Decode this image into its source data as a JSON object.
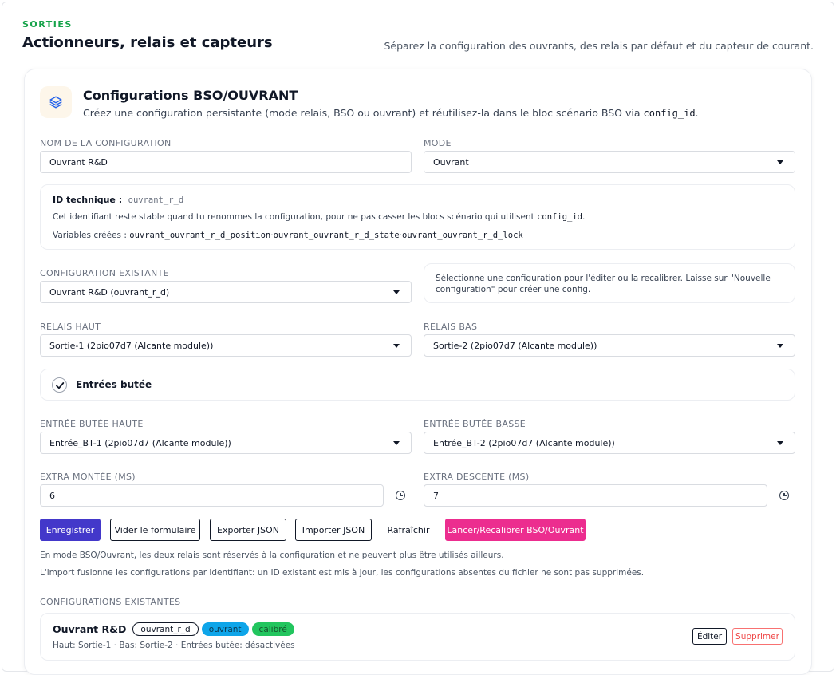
{
  "section": {
    "tag": "SORTIES",
    "title": "Actionneurs, relais et capteurs",
    "description": "Séparez la configuration des ouvrants, des relais par défaut et du capteur de courant."
  },
  "card": {
    "icon": "layers-icon",
    "title": "Configurations BSO/OUVRANT",
    "subtitle_before": "Créez une configuration persistante (mode relais, BSO ou ouvrant) et réutilisez-la dans le bloc scénario BSO via",
    "subtitle_code": "config_id",
    "subtitle_after": "."
  },
  "form": {
    "name_label": "NOM DE LA CONFIGURATION",
    "name_value": "Ouvrant R&D",
    "mode_label": "MODE",
    "mode_value": "Ouvrant",
    "tech_id_label": "ID technique :",
    "tech_id_value": "ouvrant_r_d",
    "tech_id_note_before": "Cet identifiant reste stable quand tu renommes la configuration, pour ne pas casser les blocs scénario qui utilisent",
    "tech_id_note_code": "config_id",
    "tech_id_note_after": ".",
    "variables_label": "Variables créées :",
    "variable_1": "ouvrant_ouvrant_r_d_position",
    "variable_2": "ouvrant_ouvrant_r_d_state",
    "variable_3": "ouvrant_ouvrant_r_d_lock",
    "variable_sep": "·",
    "existing_label": "CONFIGURATION EXISTANTE",
    "existing_value": "Ouvrant R&D (ouvrant_r_d)",
    "existing_help": "Sélectionne une configuration pour l'éditer ou la recalibrer. Laisse sur \"Nouvelle configuration\" pour créer une config.",
    "relay_up_label": "RELAIS HAUT",
    "relay_up_value": "Sortie-1 (2pio07d7 (Alcante module))",
    "relay_down_label": "RELAIS BAS",
    "relay_down_value": "Sortie-2 (2pio07d7 (Alcante module))",
    "limit_inputs_label": "Entrées butée",
    "limit_inputs_checked": true,
    "limit_up_label": "ENTRÉE BUTÉE HAUTE",
    "limit_up_value": "Entrée_BT-1 (2pio07d7 (Alcante module))",
    "limit_down_label": "ENTRÉE BUTÉE BASSE",
    "limit_down_value": "Entrée_BT-2 (2pio07d7 (Alcante module))",
    "extra_up_label": "EXTRA MONTÉE (MS)",
    "extra_up_value": "6",
    "extra_down_label": "EXTRA DESCENTE (MS)",
    "extra_down_value": "7"
  },
  "actions": {
    "save": "Enregistrer",
    "clear": "Vider le formulaire",
    "export": "Exporter JSON",
    "import": "Importer JSON",
    "refresh": "Rafraîchir",
    "calibrate": "Lancer/Recalibrer BSO/Ouvrant"
  },
  "notes": {
    "note_1": "En mode BSO/Ouvrant, les deux relais sont réservés à la configuration et ne peuvent plus être utilisés ailleurs.",
    "note_2": "L'import fusionne les configurations par identifiant: un ID existant est mis à jour, les configurations absentes du fichier ne sont pas supprimées."
  },
  "existing_list": {
    "label": "CONFIGURATIONS EXISTANTES",
    "items": [
      {
        "name": "Ouvrant R&D",
        "id_tag": "ouvrant_r_d",
        "mode_tag": "ouvrant",
        "status_tag": "calibré",
        "details": "Haut: Sortie-1 · Bas: Sortie-2 · Entrées butée: désactivées",
        "edit": "Éditer",
        "delete": "Supprimer"
      }
    ]
  },
  "colors": {
    "accent_green": "#16a34a",
    "primary": "#4338ca",
    "pink": "#ec2d8f",
    "pill_blue": "#0ea5e9",
    "pill_green": "#22c55e",
    "danger": "#f87171"
  }
}
